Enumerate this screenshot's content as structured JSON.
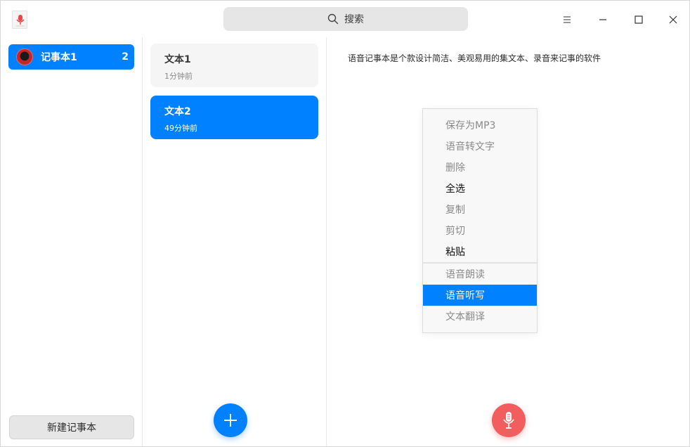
{
  "titlebar": {
    "search_placeholder": "搜索",
    "icons": {
      "app": "microphone-notepad-icon",
      "search": "search-icon",
      "menu": "hamburger-menu-icon",
      "minimize": "minimize-icon",
      "maximize": "maximize-icon",
      "close": "close-icon"
    }
  },
  "sidebar": {
    "notebooks": [
      {
        "name": "记事本1",
        "count": "2",
        "selected": true
      }
    ],
    "new_notebook_label": "新建记事本"
  },
  "notes": {
    "items": [
      {
        "title": "文本1",
        "time": "1分钟前",
        "selected": false
      },
      {
        "title": "文本2",
        "time": "49分钟前",
        "selected": true
      }
    ],
    "add_icon": "plus-icon"
  },
  "editor": {
    "content": "语音记事本是个款设计简洁、美观易用的集文本、录音来记事的软件",
    "record_icon": "microphone-icon"
  },
  "context_menu": {
    "items": [
      {
        "label": "保存为MP3",
        "state": "disabled"
      },
      {
        "label": "语音转文字",
        "state": "disabled"
      },
      {
        "label": "删除",
        "state": "disabled"
      },
      {
        "label": "全选",
        "state": "enabled"
      },
      {
        "label": "复制",
        "state": "disabled"
      },
      {
        "label": "剪切",
        "state": "disabled"
      },
      {
        "label": "粘贴",
        "state": "enabled"
      },
      {
        "label": "语音朗读",
        "state": "disabled"
      },
      {
        "label": "语音听写",
        "state": "highlighted"
      },
      {
        "label": "文本翻译",
        "state": "disabled"
      }
    ]
  },
  "colors": {
    "accent": "#0081ff",
    "record": "#f25d5d",
    "disabled_text": "#8a8a8a"
  }
}
